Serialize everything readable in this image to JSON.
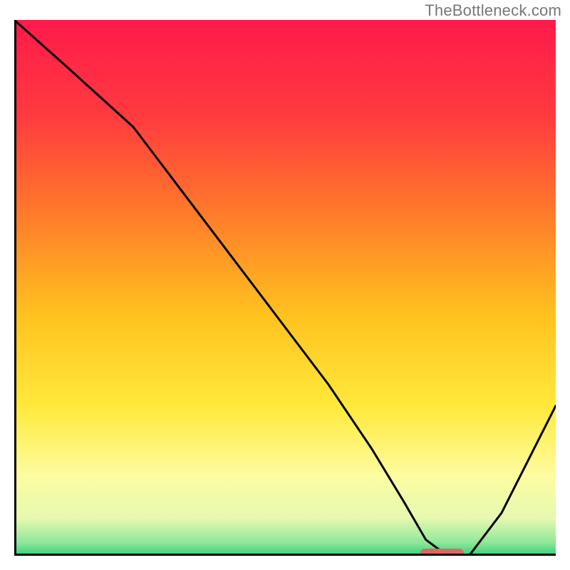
{
  "watermark": "TheBottleneck.com",
  "chart_data": {
    "type": "line",
    "title": "",
    "xlabel": "",
    "ylabel": "",
    "xlim": [
      0,
      100
    ],
    "ylim": [
      0,
      100
    ],
    "grid": false,
    "legend": false,
    "background_gradient": {
      "stops": [
        {
          "offset": 0.0,
          "color": "#ff1a4a"
        },
        {
          "offset": 0.18,
          "color": "#ff3b3f"
        },
        {
          "offset": 0.36,
          "color": "#ff7a2a"
        },
        {
          "offset": 0.55,
          "color": "#ffc21f"
        },
        {
          "offset": 0.72,
          "color": "#ffe93a"
        },
        {
          "offset": 0.85,
          "color": "#fdfca0"
        },
        {
          "offset": 0.93,
          "color": "#e6f9b0"
        },
        {
          "offset": 0.975,
          "color": "#8fe89a"
        },
        {
          "offset": 1.0,
          "color": "#33d17a"
        }
      ]
    },
    "series": [
      {
        "name": "bottleneck-curve",
        "x": [
          0,
          10,
          22,
          34,
          46,
          58,
          66,
          72,
          76,
          80,
          84,
          90,
          96,
          100
        ],
        "y": [
          100,
          91,
          80,
          64,
          48,
          32,
          20,
          10,
          3,
          0,
          0,
          8,
          20,
          28
        ]
      }
    ],
    "marker": {
      "name": "optimal-range",
      "shape": "rounded-bar",
      "x_center": 79,
      "width": 8,
      "y": 0,
      "color": "#e06666"
    }
  }
}
